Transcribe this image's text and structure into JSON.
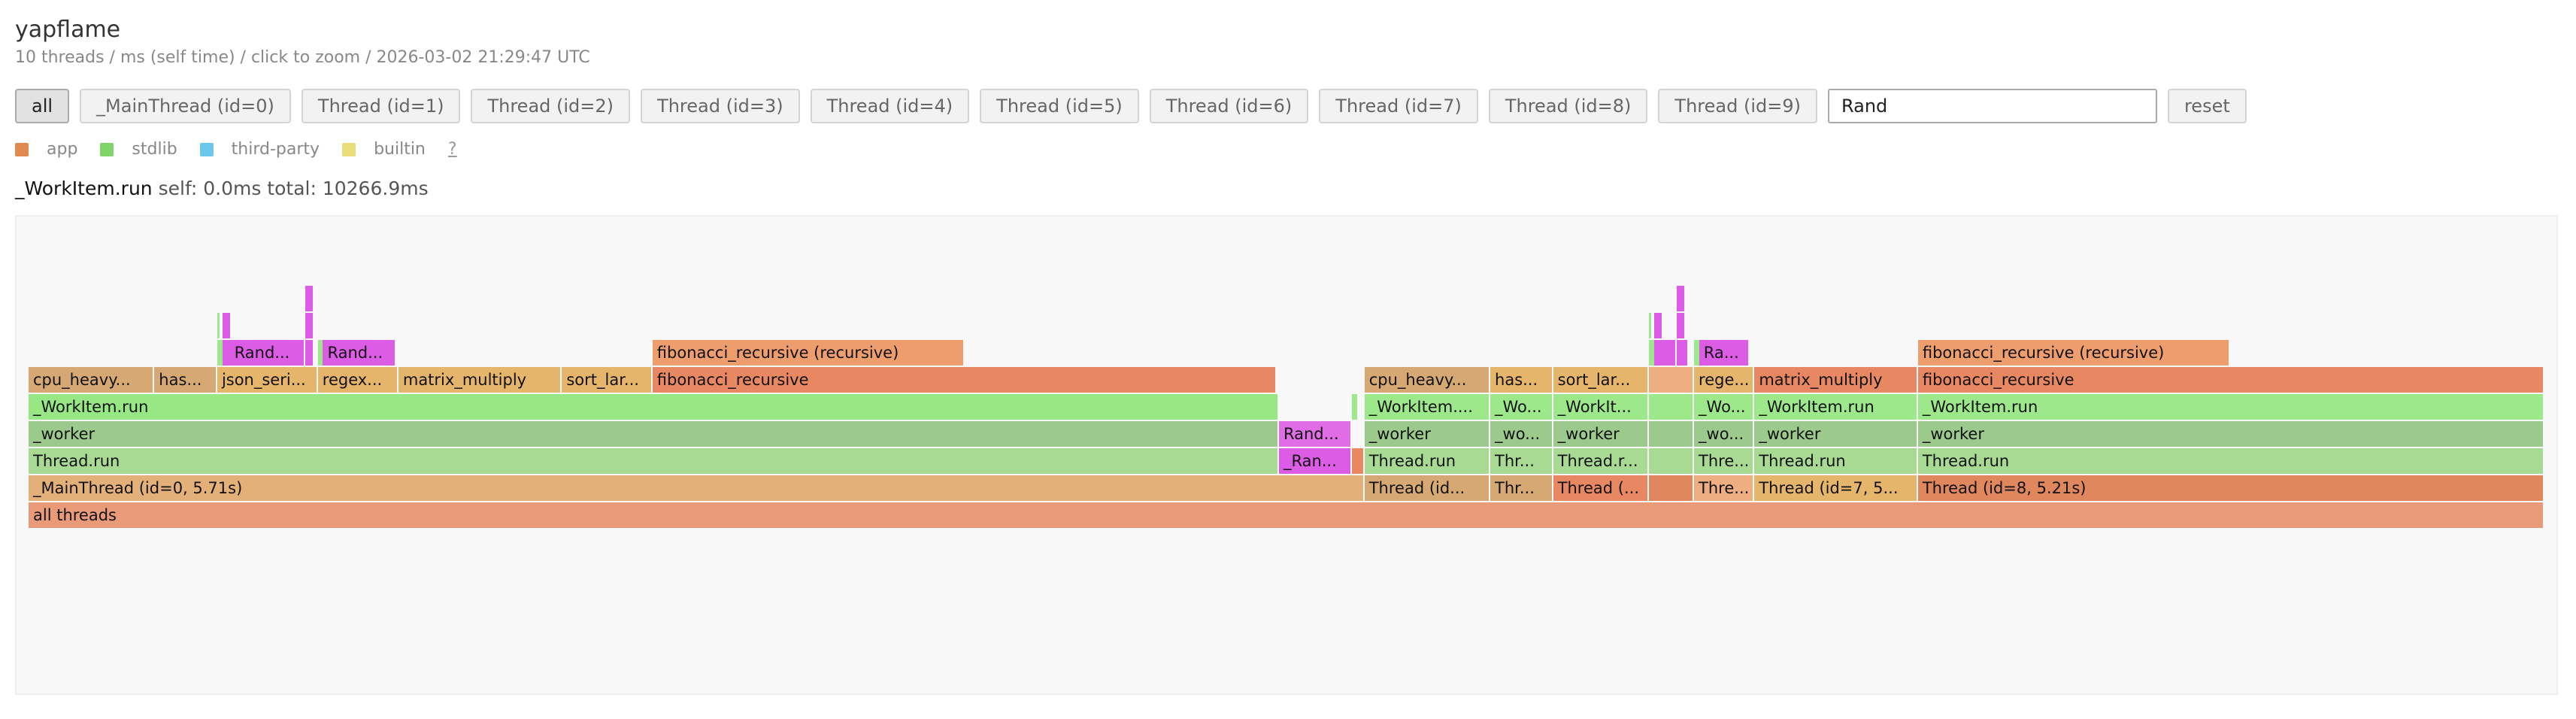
{
  "app": {
    "title": "yapflame",
    "subtitle": "10 threads / ms (self time) / click to zoom / 2026-03-02 21:29:47 UTC"
  },
  "toolbar": {
    "buttons": [
      "all",
      "_MainThread (id=0)",
      "Thread (id=1)",
      "Thread (id=2)",
      "Thread (id=3)",
      "Thread (id=4)",
      "Thread (id=5)",
      "Thread (id=6)",
      "Thread (id=7)",
      "Thread (id=8)",
      "Thread (id=9)"
    ],
    "active": "all",
    "search_value": "Rand",
    "reset_label": "reset"
  },
  "legend": {
    "items": [
      {
        "label": "app",
        "color": "#e08a50"
      },
      {
        "label": "stdlib",
        "color": "#7fd46a"
      },
      {
        "label": "third-party",
        "color": "#6cc8ea"
      },
      {
        "label": "builtin",
        "color": "#e9dc7a"
      }
    ],
    "help": "?"
  },
  "status": {
    "function": "_WorkItem.run",
    "details": "self: 0.0ms total: 10266.9ms"
  },
  "colors": {
    "app_root": "#e99a78",
    "app_main": "#e3b07a",
    "app_thread_red": "#e0875e",
    "app_thread_tan": "#d8a070",
    "app_orange": "#ee9e6c",
    "app_salmon": "#e88862",
    "app_tan": "#d6a873",
    "app_peach": "#eeae82",
    "app_gold": "#e6b56c",
    "stdlib_bright": "#9ce88a",
    "stdlib_mid": "#a8da93",
    "stdlib_dim": "#9cc98c",
    "stdlib_sel": "#97e884",
    "match": "#dd5ce6",
    "match_light": "#e06de6"
  },
  "flame": {
    "frames": [
      {
        "d": 0,
        "s": 0,
        "e": 1000,
        "label": "all threads",
        "c": "app_root"
      },
      {
        "d": 1,
        "s": 0,
        "e": 531,
        "label": "_MainThread (id=0, 5.71s)",
        "c": "app_main"
      },
      {
        "d": 1,
        "s": 531,
        "e": 581,
        "label": "Thread (id...",
        "c": "app_tan"
      },
      {
        "d": 1,
        "s": 581,
        "e": 606,
        "label": "Thr...",
        "c": "app_tan"
      },
      {
        "d": 1,
        "s": 606,
        "e": 644,
        "label": "Thread (...",
        "c": "app_salmon"
      },
      {
        "d": 1,
        "s": 644,
        "e": 662,
        "label": "",
        "c": "app_thread_red"
      },
      {
        "d": 1,
        "s": 662,
        "e": 686,
        "label": "Thre...",
        "c": "app_peach"
      },
      {
        "d": 1,
        "s": 686,
        "e": 751,
        "label": "Thread (id=7, 5...",
        "c": "app_gold"
      },
      {
        "d": 1,
        "s": 751,
        "e": 1000,
        "label": "Thread (id=8, 5.21s)",
        "c": "app_thread_red"
      },
      {
        "d": 2,
        "s": 0,
        "e": 497,
        "label": "Thread.run",
        "c": "stdlib_mid"
      },
      {
        "d": 2,
        "s": 497,
        "e": 526,
        "label": "_Ran...",
        "c": "match"
      },
      {
        "d": 2,
        "s": 526,
        "e": 531,
        "label": "",
        "c": "app_salmon"
      },
      {
        "d": 2,
        "s": 531,
        "e": 581,
        "label": "Thread.run",
        "c": "stdlib_mid"
      },
      {
        "d": 2,
        "s": 581,
        "e": 606,
        "label": "Thr...",
        "c": "stdlib_mid"
      },
      {
        "d": 2,
        "s": 606,
        "e": 644,
        "label": "Thread.r...",
        "c": "stdlib_mid"
      },
      {
        "d": 2,
        "s": 644,
        "e": 662,
        "label": "",
        "c": "stdlib_mid"
      },
      {
        "d": 2,
        "s": 662,
        "e": 686,
        "label": "Thre...",
        "c": "stdlib_mid"
      },
      {
        "d": 2,
        "s": 686,
        "e": 751,
        "label": "Thread.run",
        "c": "stdlib_mid"
      },
      {
        "d": 2,
        "s": 751,
        "e": 1000,
        "label": "Thread.run",
        "c": "stdlib_mid"
      },
      {
        "d": 3,
        "s": 0,
        "e": 497,
        "label": "_worker",
        "c": "stdlib_dim"
      },
      {
        "d": 3,
        "s": 497,
        "e": 526,
        "label": "Rand...",
        "c": "match_light"
      },
      {
        "d": 3,
        "s": 531,
        "e": 581,
        "label": "_worker",
        "c": "stdlib_dim"
      },
      {
        "d": 3,
        "s": 581,
        "e": 606,
        "label": "_wo...",
        "c": "stdlib_dim"
      },
      {
        "d": 3,
        "s": 606,
        "e": 644,
        "label": "_worker",
        "c": "stdlib_dim"
      },
      {
        "d": 3,
        "s": 644,
        "e": 662,
        "label": "",
        "c": "stdlib_dim"
      },
      {
        "d": 3,
        "s": 662,
        "e": 686,
        "label": "_wo...",
        "c": "stdlib_dim"
      },
      {
        "d": 3,
        "s": 686,
        "e": 751,
        "label": "_worker",
        "c": "stdlib_dim"
      },
      {
        "d": 3,
        "s": 751,
        "e": 1000,
        "label": "_worker",
        "c": "stdlib_dim"
      },
      {
        "d": 4,
        "s": 0,
        "e": 497,
        "label": "_WorkItem.run",
        "c": "stdlib_sel"
      },
      {
        "d": 4,
        "s": 526,
        "e": 528,
        "label": "",
        "c": "stdlib_bright"
      },
      {
        "d": 4,
        "s": 531,
        "e": 581,
        "label": "_WorkItem....",
        "c": "stdlib_bright"
      },
      {
        "d": 4,
        "s": 581,
        "e": 606,
        "label": "_Wo...",
        "c": "stdlib_bright"
      },
      {
        "d": 4,
        "s": 606,
        "e": 644,
        "label": "_WorkIt...",
        "c": "stdlib_bright"
      },
      {
        "d": 4,
        "s": 644,
        "e": 662,
        "label": "",
        "c": "stdlib_bright"
      },
      {
        "d": 4,
        "s": 662,
        "e": 686,
        "label": "_Wo...",
        "c": "stdlib_bright"
      },
      {
        "d": 4,
        "s": 686,
        "e": 751,
        "label": "_WorkItem.run",
        "c": "stdlib_bright"
      },
      {
        "d": 4,
        "s": 751,
        "e": 1000,
        "label": "_WorkItem.run",
        "c": "stdlib_bright"
      },
      {
        "d": 5,
        "s": 0,
        "e": 50,
        "label": "cpu_heavy...",
        "c": "app_tan"
      },
      {
        "d": 5,
        "s": 50,
        "e": 75,
        "label": "has...",
        "c": "app_tan"
      },
      {
        "d": 5,
        "s": 75,
        "e": 115,
        "label": "json_seri...",
        "c": "app_gold"
      },
      {
        "d": 5,
        "s": 115,
        "e": 147,
        "label": "regex...",
        "c": "app_gold"
      },
      {
        "d": 5,
        "s": 147,
        "e": 212,
        "label": "matrix_multiply",
        "c": "app_gold"
      },
      {
        "d": 5,
        "s": 212,
        "e": 248,
        "label": "sort_lar...",
        "c": "app_gold"
      },
      {
        "d": 5,
        "s": 248,
        "e": 496,
        "label": "fibonacci_recursive",
        "c": "app_salmon"
      },
      {
        "d": 5,
        "s": 531,
        "e": 581,
        "label": "cpu_heavy...",
        "c": "app_tan"
      },
      {
        "d": 5,
        "s": 581,
        "e": 606,
        "label": "has...",
        "c": "app_gold"
      },
      {
        "d": 5,
        "s": 606,
        "e": 644,
        "label": "sort_lar...",
        "c": "app_gold"
      },
      {
        "d": 5,
        "s": 644,
        "e": 662,
        "label": "",
        "c": "app_peach"
      },
      {
        "d": 5,
        "s": 662,
        "e": 686,
        "label": "rege...",
        "c": "app_gold"
      },
      {
        "d": 5,
        "s": 686,
        "e": 751,
        "label": "matrix_multiply",
        "c": "app_salmon"
      },
      {
        "d": 5,
        "s": 751,
        "e": 1000,
        "label": "fibonacci_recursive",
        "c": "app_salmon"
      },
      {
        "d": 6,
        "s": 75,
        "e": 77,
        "label": "",
        "c": "stdlib_bright"
      },
      {
        "d": 6,
        "s": 77,
        "e": 80,
        "label": "",
        "c": "match"
      },
      {
        "d": 6,
        "s": 80,
        "e": 110,
        "label": "Rand...",
        "c": "match"
      },
      {
        "d": 6,
        "s": 110,
        "e": 113,
        "label": "",
        "c": "match"
      },
      {
        "d": 6,
        "s": 115,
        "e": 117,
        "label": "",
        "c": "stdlib_bright"
      },
      {
        "d": 6,
        "s": 117,
        "e": 146,
        "label": "Rand...",
        "c": "match"
      },
      {
        "d": 6,
        "s": 248,
        "e": 372,
        "label": "fibonacci_recursive (recursive)",
        "c": "app_orange"
      },
      {
        "d": 6,
        "s": 644,
        "e": 646,
        "label": "",
        "c": "stdlib_bright"
      },
      {
        "d": 6,
        "s": 646,
        "e": 650,
        "label": "",
        "c": "match"
      },
      {
        "d": 6,
        "s": 650,
        "e": 655,
        "label": "",
        "c": "match"
      },
      {
        "d": 6,
        "s": 655,
        "e": 660,
        "label": "",
        "c": "match"
      },
      {
        "d": 6,
        "s": 662,
        "e": 664,
        "label": "",
        "c": "stdlib_bright"
      },
      {
        "d": 6,
        "s": 664,
        "e": 684,
        "label": "Ra...",
        "c": "match"
      },
      {
        "d": 6,
        "s": 751,
        "e": 875,
        "label": "fibonacci_recursive (recursive)",
        "c": "app_orange"
      },
      {
        "d": 7,
        "s": 75,
        "e": 76,
        "label": "",
        "c": "stdlib_bright"
      },
      {
        "d": 7,
        "s": 77,
        "e": 80,
        "label": "",
        "c": "match"
      },
      {
        "d": 7,
        "s": 110,
        "e": 113,
        "label": "",
        "c": "match"
      },
      {
        "d": 7,
        "s": 644,
        "e": 645,
        "label": "",
        "c": "stdlib_bright"
      },
      {
        "d": 7,
        "s": 646,
        "e": 649,
        "label": "",
        "c": "match"
      },
      {
        "d": 7,
        "s": 655,
        "e": 658,
        "label": "",
        "c": "match"
      },
      {
        "d": 8,
        "s": 110,
        "e": 113,
        "label": "",
        "c": "match"
      },
      {
        "d": 8,
        "s": 655,
        "e": 658,
        "label": "",
        "c": "match"
      }
    ]
  }
}
